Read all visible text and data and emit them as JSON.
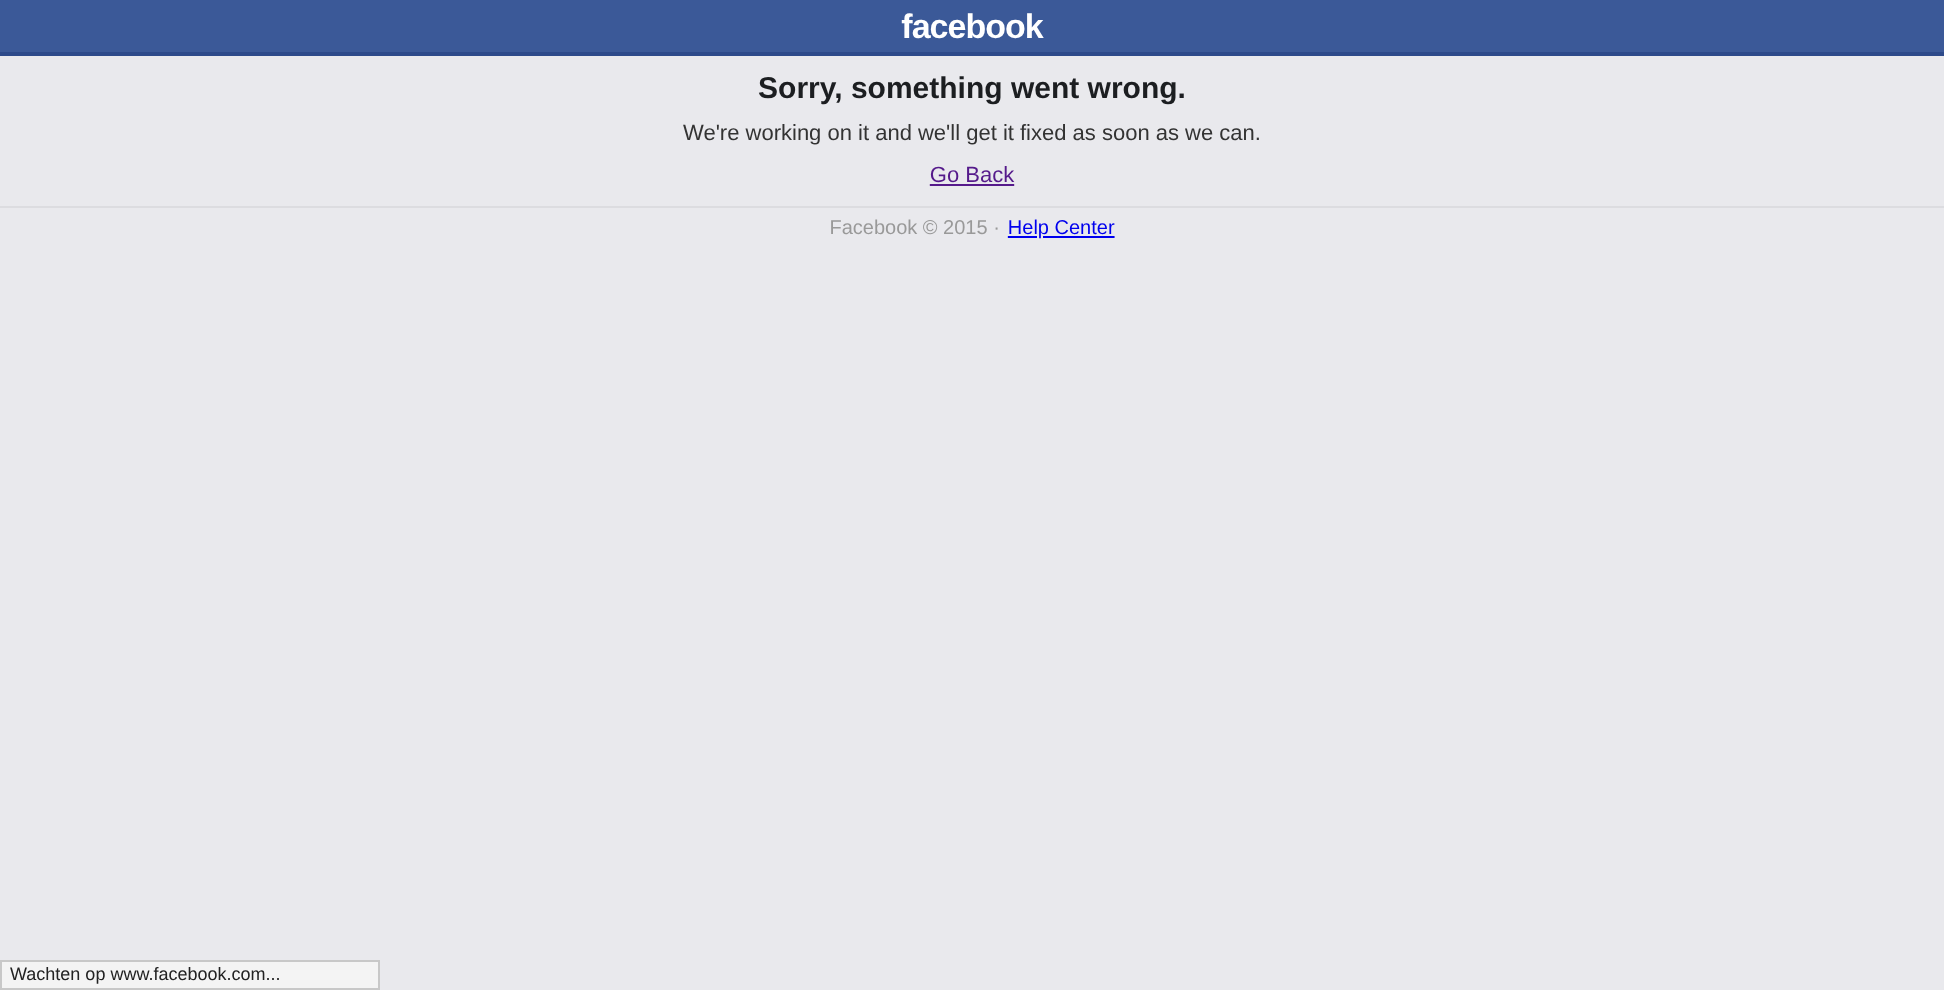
{
  "header": {
    "logo": "facebook"
  },
  "error": {
    "title": "Sorry, something went wrong.",
    "message": "We're working on it and we'll get it fixed as soon as we can.",
    "link": "Go Back"
  },
  "footer": {
    "copyright": "Facebook © 2015 ·",
    "link": "Help Center"
  },
  "status_bar": {
    "text": "Wachten op www.facebook.com..."
  }
}
